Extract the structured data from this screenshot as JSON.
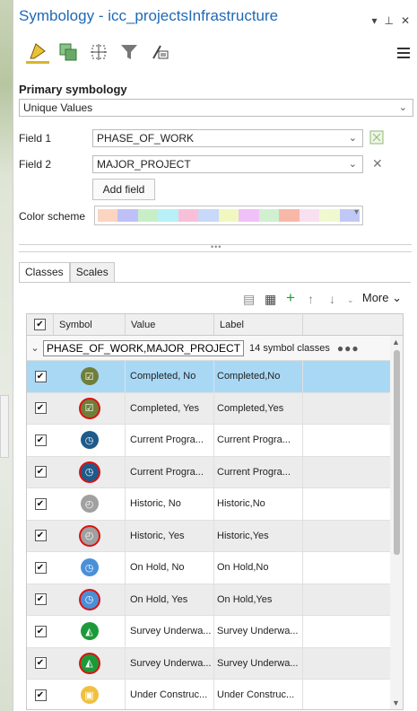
{
  "window": {
    "title": "Symbology - icc_projectsInfrastructure"
  },
  "primary_label": "Primary symbology",
  "renderer": "Unique Values",
  "field1": {
    "label": "Field 1",
    "value": "PHASE_OF_WORK"
  },
  "field2": {
    "label": "Field 2",
    "value": "MAJOR_PROJECT"
  },
  "add_field_label": "Add field",
  "color_scheme_label": "Color scheme",
  "color_scheme_swatches": [
    "#fbd5c0",
    "#c0c0f8",
    "#c8eec8",
    "#b8f0f8",
    "#f8c0d8",
    "#c8d8f8",
    "#f0f8c0",
    "#f0c0f8",
    "#d0f0d0",
    "#f8b8a8",
    "#f8e0f0",
    "#f0f8d0",
    "#c0c8f8"
  ],
  "tabs": [
    "Classes",
    "Scales"
  ],
  "more_label": "More",
  "grid": {
    "headers": [
      "Symbol",
      "Value",
      "Label"
    ],
    "group": {
      "name": "PHASE_OF_WORK,MAJOR_PROJECT",
      "count": "14 symbol classes"
    },
    "rows": [
      {
        "value": "Completed, No",
        "label": "Completed,No",
        "icon": "checkbox-icon",
        "color": "#6f7f3a",
        "ring": false
      },
      {
        "value": "Completed, Yes",
        "label": "Completed,Yes",
        "icon": "checkbox-icon",
        "color": "#6f7f3a",
        "ring": true
      },
      {
        "value": "Current Progra...",
        "label": "Current Progra...",
        "icon": "clock-icon",
        "color": "#1e5a8a",
        "ring": false
      },
      {
        "value": "Current Progra...",
        "label": "Current Progra...",
        "icon": "clock-icon",
        "color": "#1e5a8a",
        "ring": true
      },
      {
        "value": "Historic, No",
        "label": "Historic,No",
        "icon": "history-icon",
        "color": "#a0a0a0",
        "ring": false
      },
      {
        "value": "Historic, Yes",
        "label": "Historic,Yes",
        "icon": "history-icon",
        "color": "#a0a0a0",
        "ring": true
      },
      {
        "value": "On Hold, No",
        "label": "On Hold,No",
        "icon": "clock-icon",
        "color": "#4a90d9",
        "ring": false
      },
      {
        "value": "On Hold, Yes",
        "label": "On Hold,Yes",
        "icon": "clock-icon",
        "color": "#4a90d9",
        "ring": true
      },
      {
        "value": "Survey Underwa...",
        "label": "Survey Underwa...",
        "icon": "survey-icon",
        "color": "#1c9a3a",
        "ring": false
      },
      {
        "value": "Survey Underwa...",
        "label": "Survey Underwa...",
        "icon": "survey-icon",
        "color": "#1c9a3a",
        "ring": true
      },
      {
        "value": "Under Construc...",
        "label": "Under Construc...",
        "icon": "construction-icon",
        "color": "#f0c040",
        "ring": false
      }
    ]
  }
}
